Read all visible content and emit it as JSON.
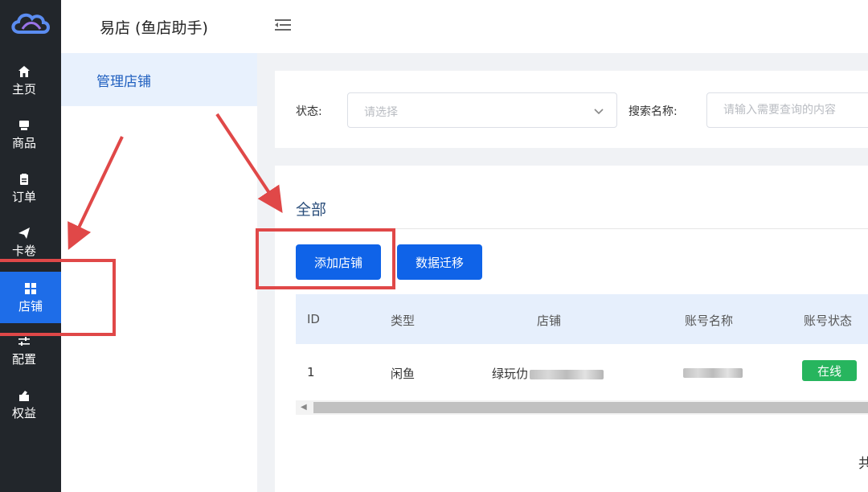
{
  "app": {
    "title": "易店 (鱼店助手)"
  },
  "rail": {
    "items": [
      {
        "label": "主页",
        "icon": "home-icon"
      },
      {
        "label": "商品",
        "icon": "goods-icon"
      },
      {
        "label": "订单",
        "icon": "order-icon"
      },
      {
        "label": "卡卷",
        "icon": "send-icon"
      },
      {
        "label": "店铺",
        "icon": "grid-icon",
        "active": true
      },
      {
        "label": "配置",
        "icon": "sliders-icon"
      },
      {
        "label": "权益",
        "icon": "rights-icon"
      }
    ]
  },
  "subnav": {
    "items": [
      {
        "label": "管理店铺",
        "active": true
      }
    ]
  },
  "filter": {
    "status_label": "状态:",
    "status_placeholder": "请选择",
    "search_label": "搜索名称:",
    "search_placeholder": "请输入需要查询的内容"
  },
  "main": {
    "section_title": "全部",
    "add_button": "添加店铺",
    "migrate_button": "数据迁移",
    "table": {
      "columns": [
        "ID",
        "类型",
        "店铺",
        "账号名称",
        "账号状态"
      ],
      "rows": [
        {
          "id": "1",
          "type": "闲鱼",
          "shop": "绿玩仂",
          "account": "",
          "status": "在线"
        }
      ]
    },
    "pager_text": "共"
  },
  "colors": {
    "accent": "#0f63e8",
    "rail_bg": "#22262b",
    "online": "#27b55e",
    "annotation": "#e04848"
  }
}
